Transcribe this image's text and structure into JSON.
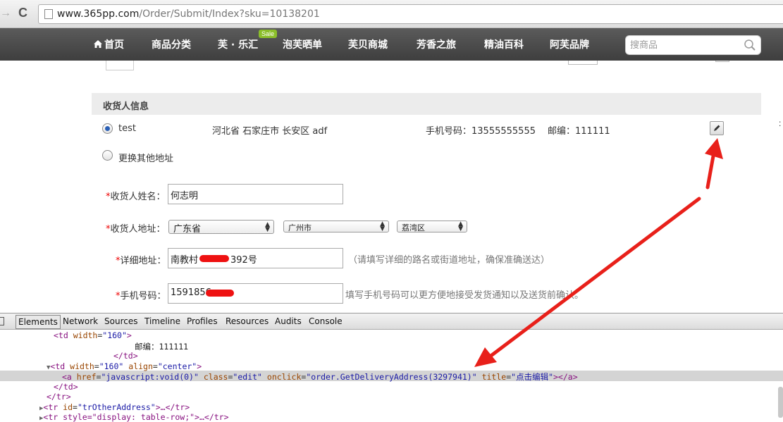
{
  "browser": {
    "url_host": "www.365pp.com",
    "url_path": "/Order/Submit/Index?sku=10138201"
  },
  "site_nav": {
    "items": [
      "首页",
      "商品分类",
      "芙 · 乐汇",
      "泡芙晒单",
      "芙贝商城",
      "芳香之旅",
      "精油百科",
      "阿芙品牌"
    ],
    "sale_badge": "Sale",
    "search_placeholder": "搜商品"
  },
  "section": {
    "title": "收货人信息"
  },
  "saved_address": {
    "name": "test",
    "address": "河北省 石家庄市 长安区 adf",
    "phone": "手机号码：13555555555",
    "zipcode": "邮编：111111",
    "selected": true
  },
  "other_address_label": "更换其他地址",
  "form": {
    "name_label": "收货人姓名：",
    "name_value": "何志明",
    "address_label": "收货人地址：",
    "province": "广东省",
    "city": "广州市",
    "district": "荔湾区",
    "detail_label": "详细地址：",
    "detail_value_prefix": "南教村",
    "detail_value_suffix": "392号",
    "detail_hint": "（请填写详细的路名或街道地址，确保准确送达）",
    "phone_label": "手机号码：",
    "phone_value": "1591856",
    "phone_hint": "填写手机号码可以更方便地接受发货通知以及送货前确认。",
    "required_mark": "*"
  },
  "devtools": {
    "tabs": [
      "Elements",
      "Network",
      "Sources",
      "Timeline",
      "Profiles",
      "Resources",
      "Audits",
      "Console"
    ],
    "selected_tab": "Elements",
    "lines": {
      "l1_tag": "<td",
      "l1_attr": "width",
      "l1_val": "\"160\"",
      "l1_close": ">",
      "l2_text": "邮编：111111",
      "l3": "</td>",
      "l4_tag": "<td",
      "l4_attr1": "width",
      "l4_val1": "\"160\"",
      "l4_attr2": "align",
      "l4_val2": "\"center\"",
      "l4_close": ">",
      "l5_tag": "<a",
      "l5_attr1": "href",
      "l5_val1": "\"javascript:void(0)\"",
      "l5_attr2": "class",
      "l5_val2": "\"edit\"",
      "l5_attr3": "onclick",
      "l5_val3": "\"order.GetDeliveryAddress(3297941)\"",
      "l5_attr4": "title",
      "l5_val4": "\"点击编辑\"",
      "l5_close": "></a>",
      "l6": "</td>",
      "l7": "</tr>",
      "l8_tag": "<tr",
      "l8_attr": "id",
      "l8_val": "\"trOtherAddress\"",
      "l8_close": ">…</tr>",
      "l9": "<tr style=\"display: table-row;\">…</tr>"
    }
  },
  "colors": {
    "annotation_arrow": "#e8201a",
    "nav_bg": "#4a4a4a",
    "required": "#ee0000"
  }
}
